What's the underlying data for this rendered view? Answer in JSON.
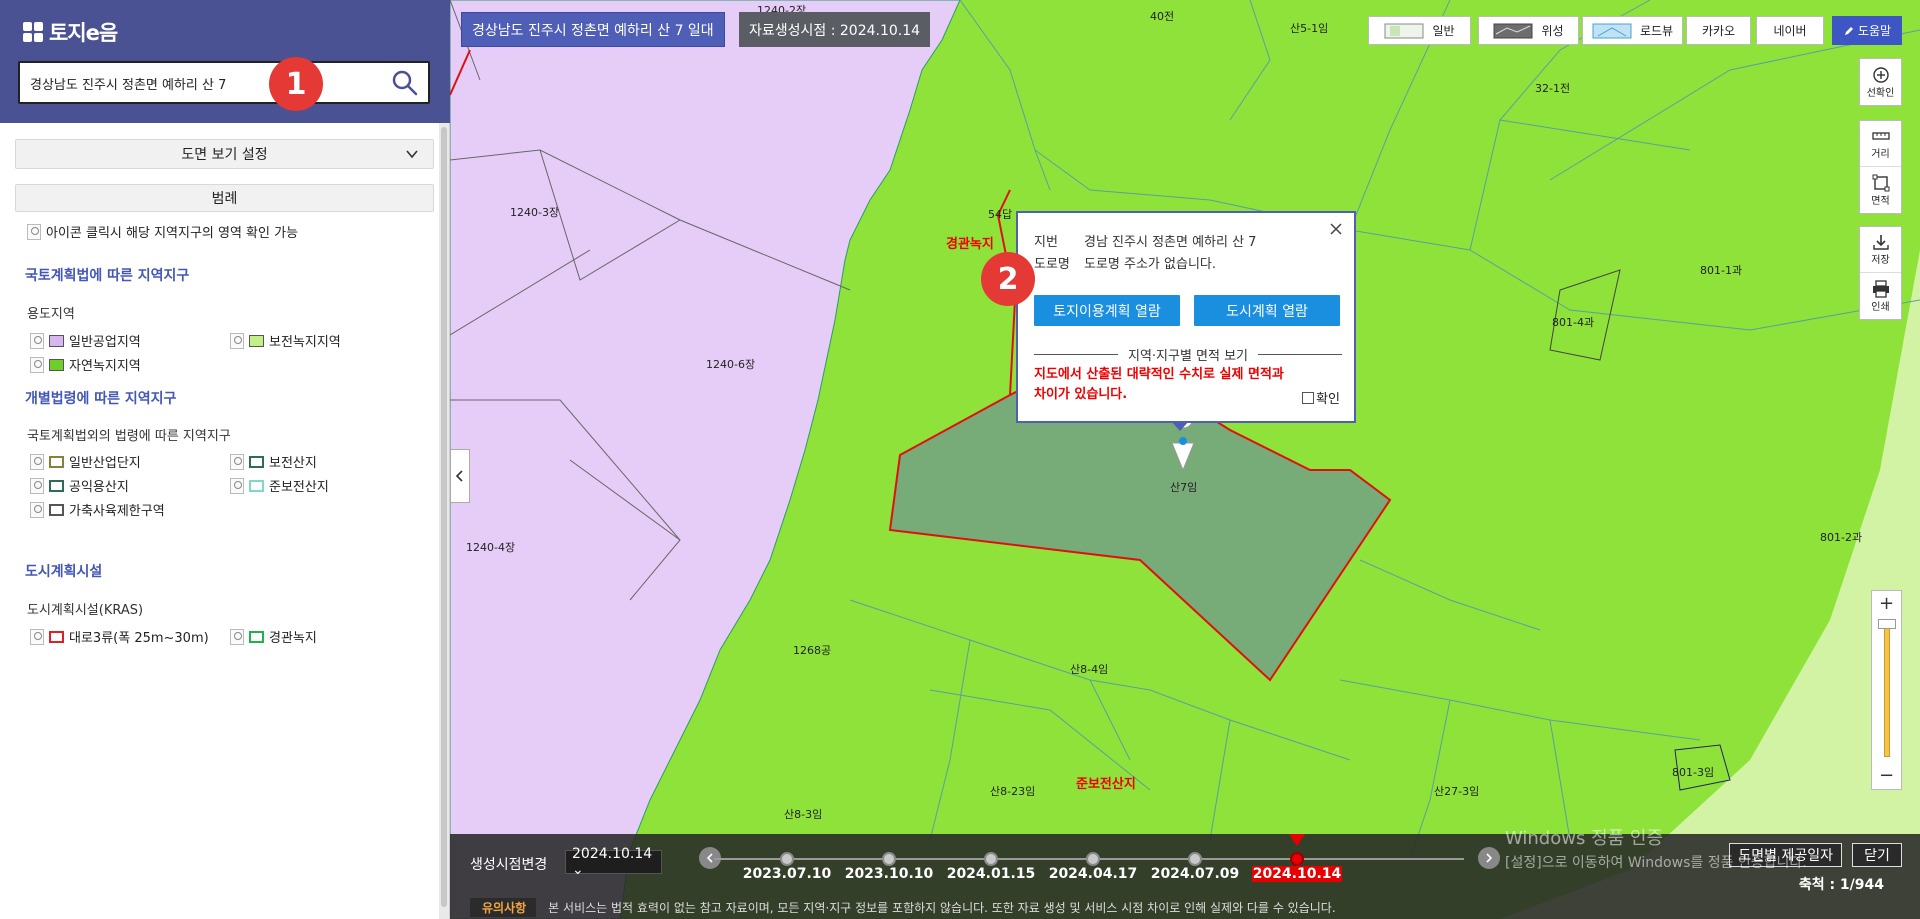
{
  "sidebar": {
    "logo_text": "토지e음",
    "logo_mark": "",
    "search": {
      "value": "경상남도 진주시 정촌면 예하리 산 7",
      "icon": "search-icon"
    },
    "view_setting_label": "도면 보기 설정",
    "legend_label": "범례",
    "legend_note": "아이콘 클릭시 해당 지역지구의 영역 확인 가능",
    "sections": {
      "national_title": "국토계획법에 따른 지역지구",
      "zoning_title": "용도지역",
      "zoning": [
        {
          "label": "일반공업지역",
          "color": "#d7b6f2"
        },
        {
          "label": "보전녹지지역",
          "color": "#c3f085"
        },
        {
          "label": "자연녹지지역",
          "color": "#6fcf2a"
        }
      ],
      "individual_title": "개별법령에 따른 지역지구",
      "individual_sub": "국토계획법외의 법령에 따른 지역지구",
      "individual": [
        {
          "label": "일반산업단지",
          "color": "#8a7f3a"
        },
        {
          "label": "보전산지",
          "color": "#2f6b5a"
        },
        {
          "label": "공익용산지",
          "color": "#2f6b5a"
        },
        {
          "label": "준보전산지",
          "color": "#7fd9c9"
        },
        {
          "label": "가축사육제한구역",
          "color": "#555555"
        }
      ],
      "urban_title": "도시계획시설",
      "urban_sub": "도시계획시설(KRAS)",
      "urban": [
        {
          "label": "대로3류(폭 25m~30m)",
          "color": "#e02020"
        },
        {
          "label": "경관녹지",
          "color": "#22b24c"
        }
      ]
    }
  },
  "badges": {
    "one": "1",
    "two": "2"
  },
  "map": {
    "address_chip": "경상남도 진주시 정촌면 예하리 산 7 일대",
    "date_chip": "자료생성시점 : 2024.10.14",
    "basemaps": [
      "일반",
      "위성",
      "로드뷰"
    ],
    "external": [
      "카카오",
      "네이버"
    ],
    "help": "도움말",
    "tools": {
      "select": "선확인",
      "distance": "거리",
      "area": "면적",
      "save": "저장",
      "print": "인쇄"
    },
    "zoom_in": "+",
    "zoom_out": "−",
    "labels": {
      "l40": "40전",
      "l5_1": "산5-1임",
      "l32_1": "32-1전",
      "l1240_3": "1240-3장",
      "l1240_6": "1240-6장",
      "l1240_4": "1240-4장",
      "l54": "54답",
      "scenic_red": "경관녹지",
      "l801_1": "801-1과",
      "l801_4": "801-4과",
      "l801_2": "801-2과",
      "l7": "산7임",
      "l1268": "1268공",
      "l8_4": "산8-4임",
      "l8_23": "산8-23임",
      "l8_3": "산8-3임",
      "junbo_red": "준보전산지",
      "l27_3": "산27-3임",
      "l801_3": "801-3임",
      "l1240_2": "1240-2장"
    },
    "colors": {
      "industrial": "#e6cdf8",
      "green": "#8ee23a",
      "light_green": "#d2f3a4",
      "parcel_fill": "#77ab77",
      "parcel_line": "#e01010"
    }
  },
  "popup": {
    "jibun_key": "지번",
    "jibun_val": "경남 진주시 정촌면 예하리 산 7",
    "road_key": "도로명",
    "road_val": "도로명 주소가 없습니다.",
    "btn_land": "토지이용계획 열람",
    "btn_city": "도시계획 열람",
    "area_title": "지역·지구별 면적 보기",
    "warning": "지도에서 산출된 대략적인 수치로 실제 면적과 차이가 있습니다.",
    "confirm": "확인"
  },
  "timeline": {
    "label": "생성시점변경",
    "selected": "2024.10.14 ⌄",
    "dates": [
      "2023.07.10",
      "2023.10.10",
      "2024.01.15",
      "2024.04.17",
      "2024.07.09",
      "2024.10.14"
    ],
    "active_index": 5,
    "provided_btn": "도면별 제공일자",
    "close_btn": "닫기",
    "scale": "축척 : 1/944",
    "notice_tag": "유의사항",
    "notice_text": "본 서비스는 법적 효력이 없는 참고 자료이며, 모든 지역·지구 정보를 포함하지 않습니다. 또한 자료 생성 및 서비스 시점 차이로 인해 실제와 다를 수 있습니다."
  },
  "watermark": {
    "line1": "Windows 정품 인증",
    "line2": "[설정]으로 이동하여 Windows를 정품 인증합니다."
  }
}
